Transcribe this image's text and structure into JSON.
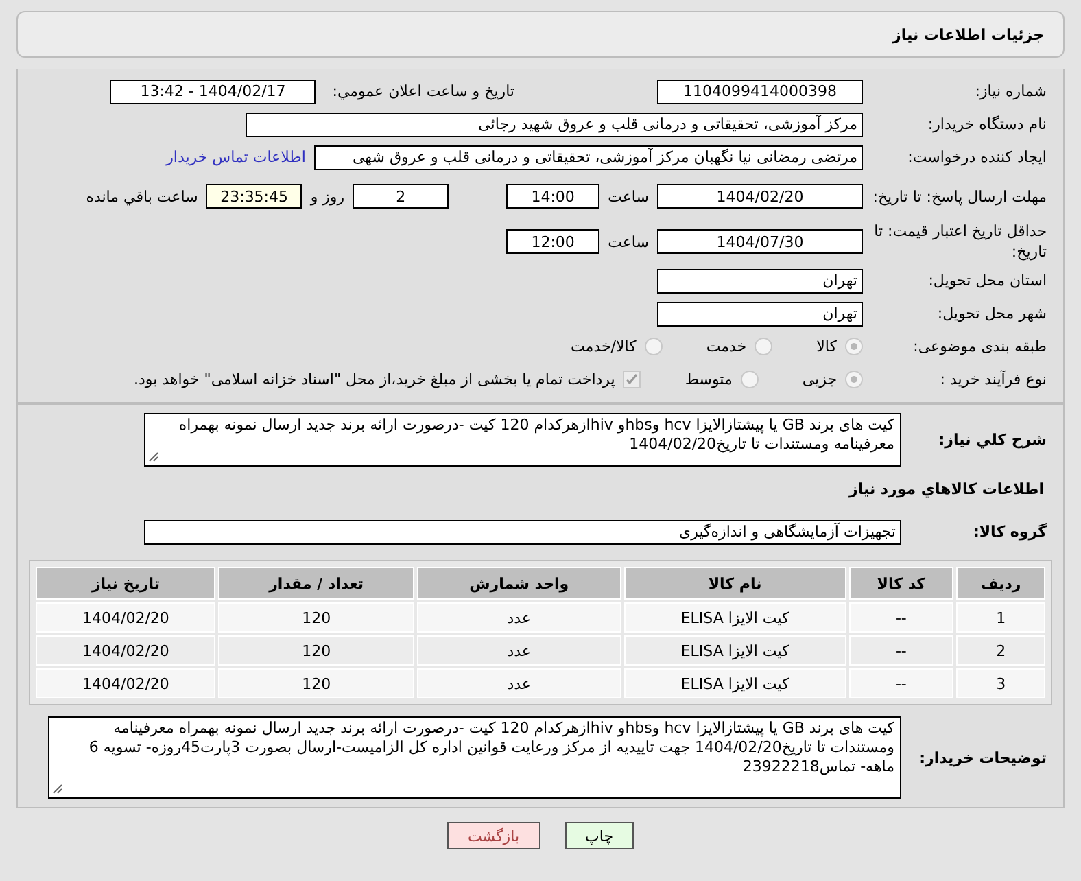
{
  "header": {
    "title": "جزئیات اطلاعات نیاز"
  },
  "need_number": {
    "label": "شماره نیاز:",
    "value": "1104099414000398"
  },
  "announce": {
    "label": "تاریخ و ساعت اعلان عمومي:",
    "value": "1404/02/17 - 13:42"
  },
  "buyer": {
    "label": "نام دستگاه خریدار:",
    "value": "مرکز آموزشی، تحقیقاتی و درمانی قلب و عروق شهید رجائی"
  },
  "creator": {
    "label": "ایجاد کننده درخواست:",
    "value": "مرتضی رمضانی نیا نگهبان مرکز آموزشی، تحقیقاتی و درمانی قلب و عروق شهی",
    "link": "اطلاعات تماس خریدار"
  },
  "deadline": {
    "label": "مهلت ارسال پاسخ: تا تاریخ:",
    "date": "1404/02/20",
    "time_label": "ساعت",
    "time": "14:00",
    "days": "2",
    "days_label": "روز و",
    "remaining": "23:35:45",
    "remaining_label": "ساعت باقي مانده"
  },
  "validity": {
    "label": "حداقل تاریخ اعتبار قیمت: تا تاریخ:",
    "date": "1404/07/30",
    "time_label": "ساعت",
    "time": "12:00"
  },
  "province": {
    "label": "استان محل تحویل:",
    "value": "تهران"
  },
  "city": {
    "label": "شهر محل تحویل:",
    "value": "تهران"
  },
  "category": {
    "label": "طبقه بندی موضوعی:",
    "options": [
      {
        "label": "کالا",
        "selected": true
      },
      {
        "label": "خدمت",
        "selected": false
      },
      {
        "label": "کالا/خدمت",
        "selected": false
      }
    ]
  },
  "process": {
    "label": "نوع فرآیند خرید :",
    "options": [
      {
        "label": "جزیی",
        "selected": true
      },
      {
        "label": "متوسط",
        "selected": false
      }
    ],
    "treasury": {
      "checked": true,
      "text": "پرداخت تمام یا بخشی از مبلغ خرید،از محل \"اسناد خزانه اسلامی\" خواهد بود."
    }
  },
  "description": {
    "label": "شرح کلي نياز:",
    "value": "کیت های  برند GB یا پیشتازالایزا hcv وhbsو  hivازهرکدام 120 کیت -درصورت ارائه برند جدید ارسال نمونه بهمراه معرفینامه ومستندات تا تاریخ1404/02/20"
  },
  "goods_heading": "اطلاعات کالاهاي مورد نياز",
  "goods_group": {
    "label": "گروه کالا:",
    "value": "تجهیزات آزمایشگاهی و اندازه‌گیری"
  },
  "table": {
    "columns": [
      "ردیف",
      "کد کالا",
      "نام کالا",
      "واحد شمارش",
      "تعداد / مقدار",
      "تاریخ نیاز"
    ],
    "rows": [
      [
        "1",
        "--",
        "کیت الایزا ELISA",
        "عدد",
        "120",
        "1404/02/20"
      ],
      [
        "2",
        "--",
        "کیت الایزا ELISA",
        "عدد",
        "120",
        "1404/02/20"
      ],
      [
        "3",
        "--",
        "کیت الایزا ELISA",
        "عدد",
        "120",
        "1404/02/20"
      ]
    ]
  },
  "buyer_notes": {
    "label": "توضیحات خریدار:",
    "value": "کیت های  برند GB یا پیشتازالایزا hcv وhbsو  hivازهرکدام 120 کیت -درصورت ارائه برند جدید ارسال نمونه بهمراه معرفینامه ومستندات تا تاریخ1404/02/20 جهت تاییدیه  از مرکز ورعایت قوانین اداره کل الزامیست-ارسال بصورت 3پارت45روزه- تسویه 6 ماهه- تماس23922218"
  },
  "buttons": [
    {
      "label": "چاپ",
      "kind": "print"
    },
    {
      "label": "بازگشت",
      "kind": "back"
    }
  ]
}
